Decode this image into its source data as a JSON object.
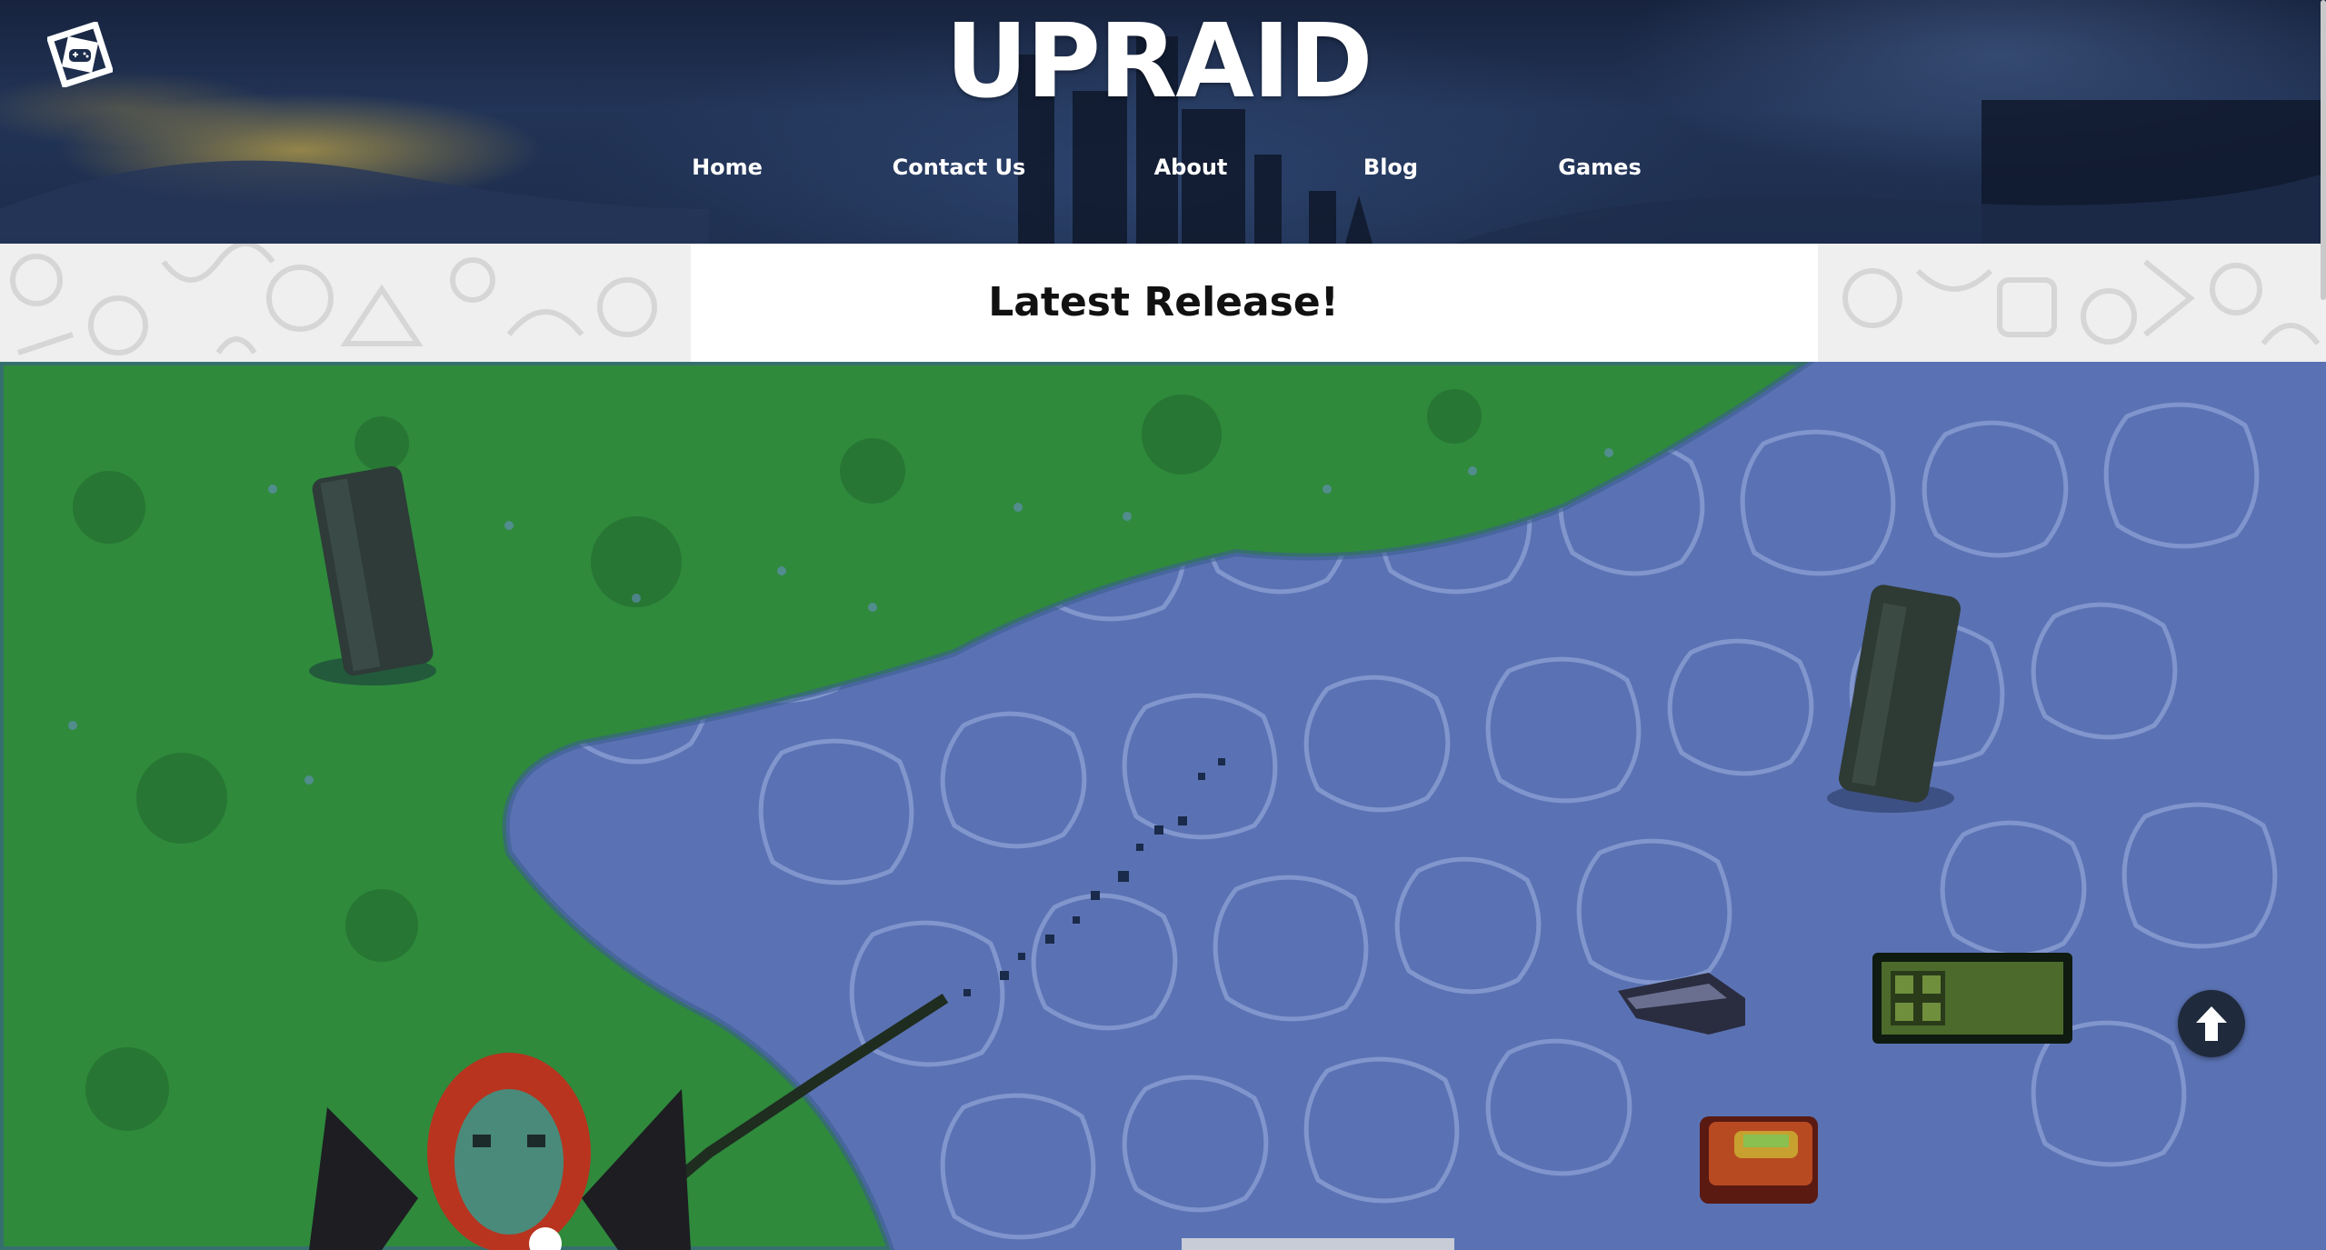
{
  "site": {
    "title": "UPRAID",
    "logo_icon": "gamepad-icon"
  },
  "nav": {
    "items": [
      {
        "label": "Home"
      },
      {
        "label": "Contact Us"
      },
      {
        "label": "About"
      },
      {
        "label": "Blog"
      },
      {
        "label": "Games"
      }
    ]
  },
  "banner": {
    "title": "Latest Release!"
  },
  "video": {
    "scene": "game-footage"
  },
  "controls": {
    "scroll_top_icon": "arrow-up-icon"
  },
  "colors": {
    "header_bg": "#1c2c4b",
    "grass": "#2f8a3c",
    "water": "#5a72b3",
    "button_bg": "#1f2a3c"
  }
}
